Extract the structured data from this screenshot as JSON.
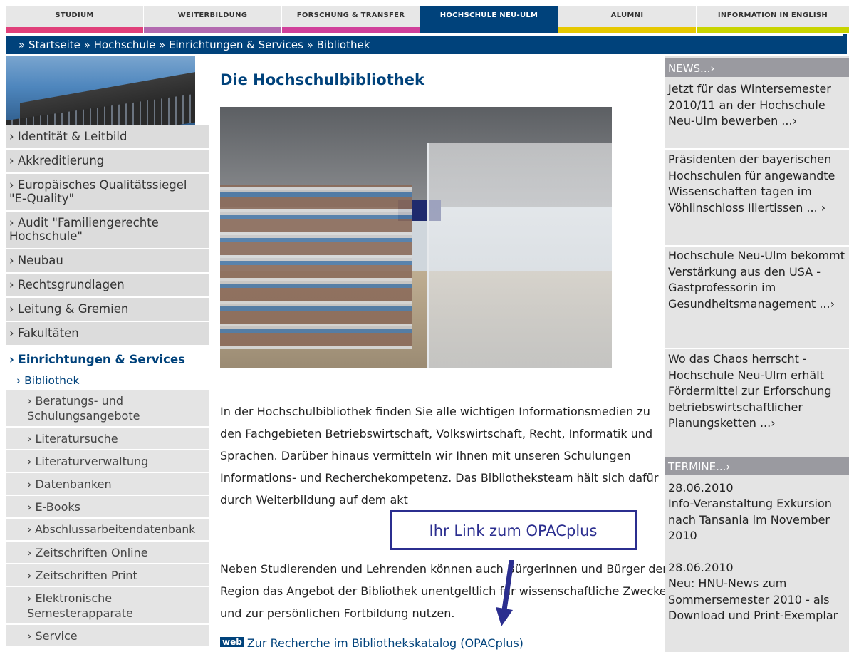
{
  "topnav": [
    {
      "label": "STUDIUM",
      "color": "#e0407a",
      "width": 194
    },
    {
      "label": "WEITERBILDUNG",
      "color": "#b36ab0",
      "width": 194
    },
    {
      "label": "FORSCHUNG & TRANSFER",
      "color": "#d0409a",
      "width": 194
    },
    {
      "label": "HOCHSCHULE NEU-ULM",
      "color": "#00427b",
      "width": 194,
      "active": true
    },
    {
      "label": "ALUMNI",
      "color": "#e6c800",
      "width": 194
    },
    {
      "label": "INFORMATION IN ENGLISH",
      "color": "#c8d400",
      "width": 214
    }
  ],
  "breadcrumb": "» Startseite » Hochschule » Einrichtungen & Services » Bibliothek",
  "leftnav": {
    "level1": [
      "› Identität & Leitbild",
      "› Akkreditierung",
      "› Europäisches Qualitätssiegel \"E-Quality\"",
      "› Audit \"Familiengerechte Hochschule\"",
      "› Neubau",
      "› Rechtsgrundlagen",
      "› Leitung & Gremien",
      "› Fakultäten"
    ],
    "active": "› Einrichtungen & Services",
    "level2": "› Bibliothek",
    "level3": [
      "› Beratungs- und Schulungsangebote",
      "› Literatursuche",
      "› Literaturverwaltung",
      "› Datenbanken",
      "› E-Books",
      "› Abschlussarbeitendatenbank",
      "› Zeitschriften Online",
      "› Zeitschriften Print",
      "› Elektronische Semesterapparate",
      "› Service"
    ]
  },
  "main": {
    "title": "Die Hochschulbibliothek",
    "para1": "In der Hochschulbibliothek finden Sie alle wichtigen Informationsmedien zu den Fachgebieten Betriebswirtschaft, Volkswirtschaft, Recht, Informatik und Sprachen. Darüber hinaus vermitteln wir Ihnen mit unseren Schulungen Informations- und Recherchekompetenz. Das Bibliotheksteam hält sich dafür durch Weiterbildung auf dem akt",
    "para2": "Neben Studierenden und Lehrenden können auch Bürgerinnen und Bürger der Region das Angebot der Bibliothek unentgeltlich für wissenschaftliche Zwecke und zur persönlichen Fortbildung nutzen.",
    "web_badge": "web",
    "catalog_link": "Zur Recherche im Bibliothekskatalog (OPACplus)",
    "callout": "Ihr Link zum OPACplus"
  },
  "news": {
    "header": "NEWS...›",
    "items": [
      "Jetzt für das Wintersemester 2010/11 an der Hochschule Neu-Ulm bewerben ...›",
      "Präsidenten der bayerischen Hochschulen für angewandte Wissenschaften tagen im Vöhlinschloss Illertissen ... ›",
      "Hochschule Neu-Ulm bekommt Verstärkung aus den USA - Gastprofessorin im Gesundheitsmanagement ...›",
      "Wo das Chaos herrscht - Hochschule Neu-Ulm erhält Fördermittel zur Erforschung betriebswirtschaftlicher Planungsketten ...›"
    ]
  },
  "termine": {
    "header": "TERMINE...›",
    "items": [
      {
        "date": "28.06.2010",
        "text": "Info-Veranstaltung Exkursion nach Tansania im November 2010"
      },
      {
        "date": "28.06.2010",
        "text": "Neu: HNU-News zum Sommersemester 2010 - als Download und Print-Exemplar"
      }
    ]
  }
}
